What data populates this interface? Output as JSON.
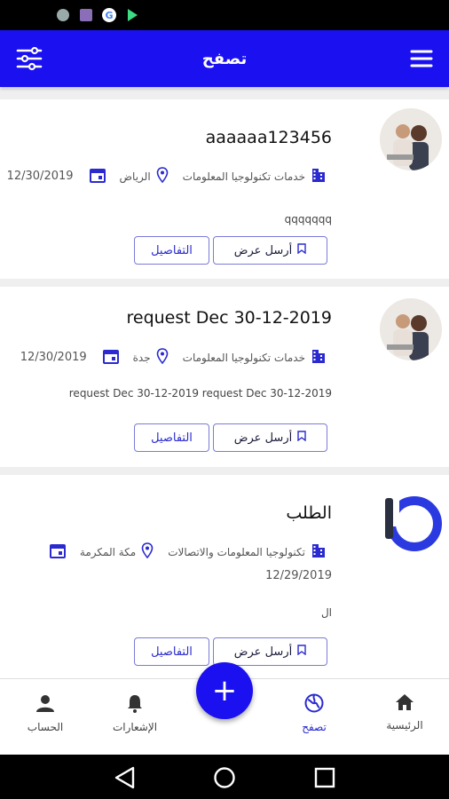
{
  "appbar": {
    "title": "تصفح"
  },
  "requests": [
    {
      "title": "aaaaaa123456",
      "category": "خدمات تكنولوجيا المعلومات",
      "city": "الرياض",
      "date": "12/30/2019",
      "description": "qqqqqqq",
      "offer_label": "أرسل عرض",
      "details_label": "التفاصيل"
    },
    {
      "title": "request Dec 30-12-2019",
      "category": "خدمات تكنولوجيا المعلومات",
      "city": "جدة",
      "date": "12/30/2019",
      "description": "request Dec 30-12-2019 request Dec 30-12-2019",
      "offer_label": "أرسل عرض",
      "details_label": "التفاصيل"
    },
    {
      "title": "الطلب",
      "category": "تكنولوجيا المعلومات والاتصالات",
      "city": "مكة المكرمة",
      "date": "12/29/2019",
      "description": "ال",
      "offer_label": "أرسل عرض",
      "details_label": "التفاصيل"
    }
  ],
  "bottom_nav": {
    "home": "الرئيسية",
    "browse": "تصفح",
    "notifications": "الإشعارات",
    "account": "الحساب"
  },
  "fab_label": "+",
  "colors": {
    "primary": "#1a10f0",
    "accent": "#2a2ad0"
  },
  "icons": [
    "menu-icon",
    "filter-icon",
    "building-icon",
    "location-icon",
    "calendar-icon",
    "bookmark-icon",
    "home-icon",
    "globe-icon",
    "bell-icon",
    "person-icon"
  ]
}
